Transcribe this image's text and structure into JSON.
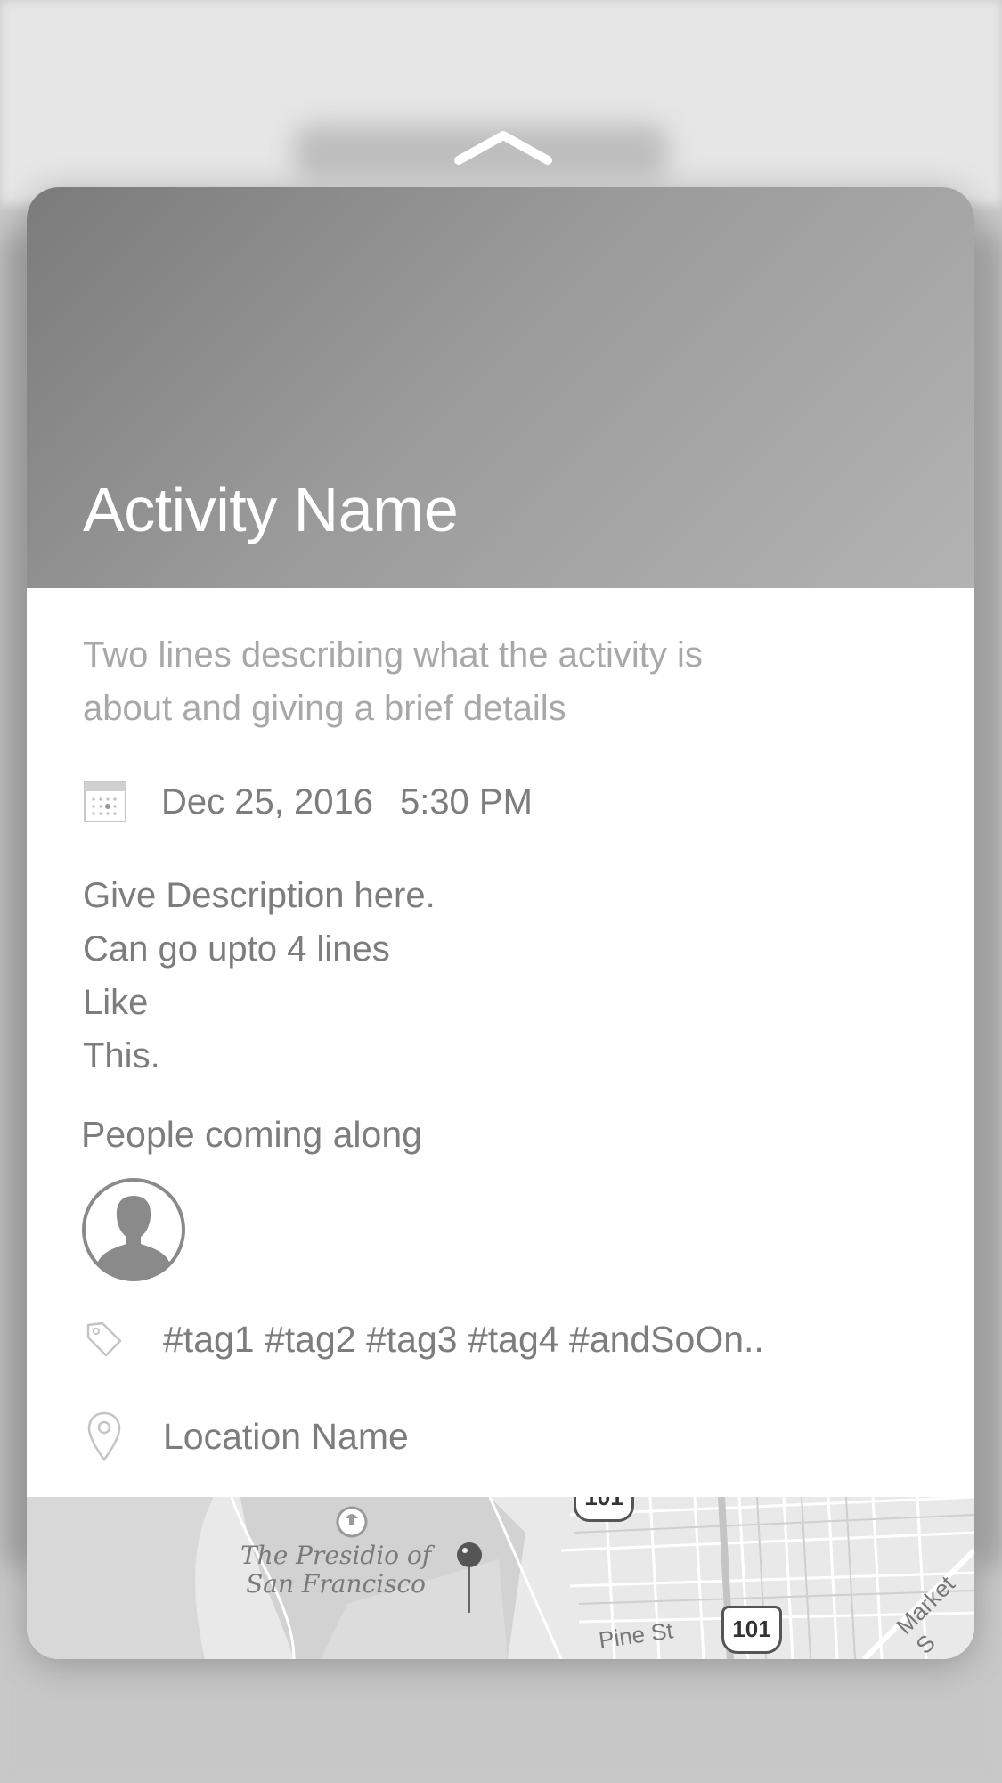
{
  "activity": {
    "title": "Activity Name",
    "subtitle_line1": "Two lines describing what the activity is",
    "subtitle_line2": "about and giving a brief details",
    "date": "Dec 25, 2016",
    "time": "5:30 PM",
    "description": [
      "Give Description here.",
      "Can go upto 4 lines",
      "Like",
      "This."
    ],
    "people_label": "People coming along",
    "tags": "#tag1 #tag2 #tag3 #tag4 #andSoOn..",
    "location": "Location Name"
  },
  "map": {
    "place_line1": "The Presidio of",
    "place_line2": "San Francisco",
    "street1": "Pine St",
    "street2": "Market S",
    "highway": "101",
    "highway_top": "101"
  },
  "icons": {
    "collapse": "chevron-up-icon",
    "calendar": "calendar-icon",
    "avatar": "person-avatar-icon",
    "tag": "tag-icon",
    "location": "location-pin-icon"
  }
}
